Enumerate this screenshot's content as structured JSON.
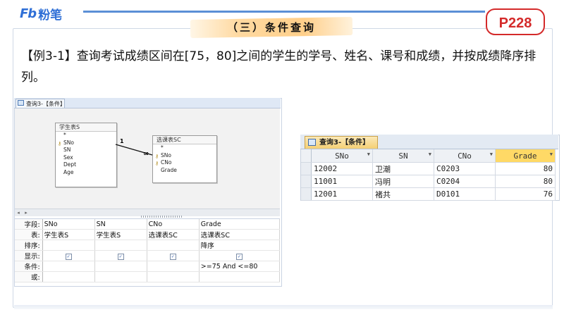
{
  "brand": {
    "logo_mark": "Fb",
    "name": "粉笔"
  },
  "section_title": "（三）条件查询",
  "page_badge": "P228",
  "question": "【例3-1】查询考试成绩区间在[75，80]之间的学生的学号、姓名、课号和成绩，并按成绩降序排列。",
  "design_window": {
    "tab_label": "查询3-【条件】",
    "table_student": {
      "title": "学生表S",
      "fields": [
        "*",
        "SNo",
        "SN",
        "Sex",
        "Dept",
        "Age"
      ],
      "key_field": "SNo"
    },
    "table_course": {
      "title": "选课表SC",
      "fields": [
        "*",
        "SNo",
        "CNo",
        "Grade"
      ],
      "key_fields": [
        "SNo",
        "CNo"
      ]
    },
    "relation": {
      "one": "1",
      "many": "∞"
    },
    "grid": {
      "row_headers": [
        "字段:",
        "表:",
        "排序:",
        "显示:",
        "条件:",
        "或:"
      ],
      "columns": [
        {
          "field": "SNo",
          "table": "学生表S",
          "sort": "",
          "show": true,
          "criteria": ""
        },
        {
          "field": "SN",
          "table": "学生表S",
          "sort": "",
          "show": true,
          "criteria": ""
        },
        {
          "field": "CNo",
          "table": "选课表SC",
          "sort": "",
          "show": true,
          "criteria": ""
        },
        {
          "field": "Grade",
          "table": "选课表SC",
          "sort": "降序",
          "show": true,
          "criteria": ">=75 And <=80"
        }
      ]
    }
  },
  "datasheet": {
    "tab_label": "查询3-【条件】",
    "headers": [
      "SNo",
      "SN",
      "CNo",
      "Grade"
    ],
    "rows": [
      [
        "12002",
        "卫潮",
        "C0203",
        "80"
      ],
      [
        "11001",
        "冯明",
        "C0204",
        "80"
      ],
      [
        "12001",
        "褚共",
        "D0101",
        "76"
      ]
    ]
  },
  "colors": {
    "accent_blue": "#2f6fd6",
    "badge_red": "#d42a2a",
    "highlight_orange": "#ffcf8a",
    "grade_header": "#ffd966"
  }
}
